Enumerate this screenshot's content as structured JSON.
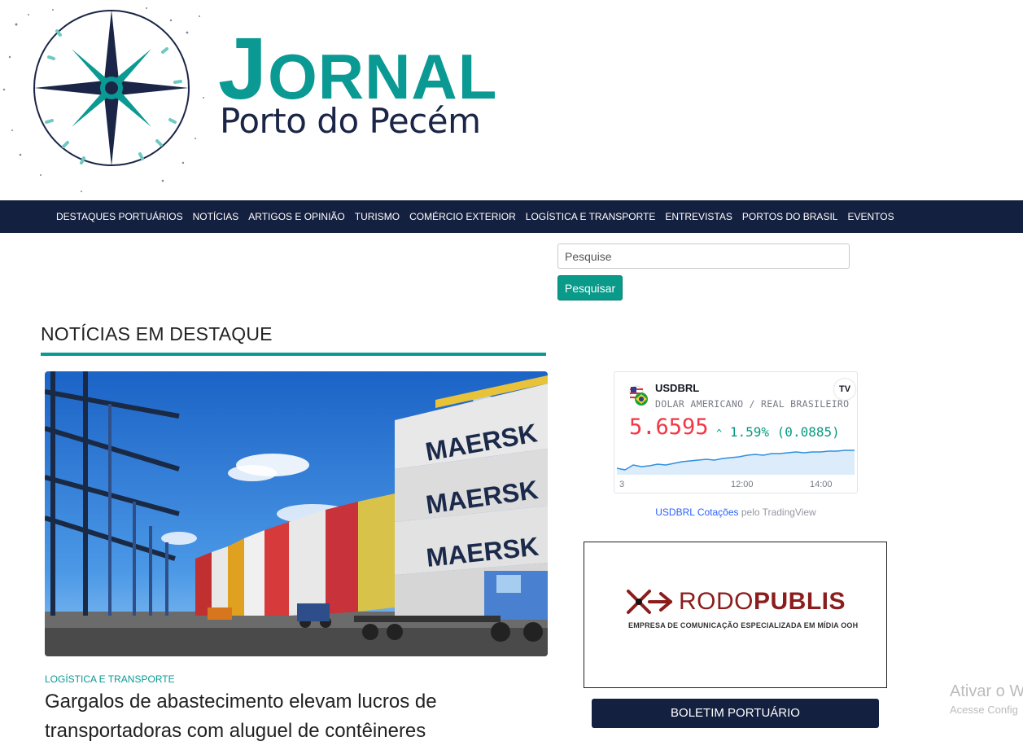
{
  "header": {
    "title_big": "J",
    "title_rest": "ORNAL",
    "subtitle": "Porto do Pecém"
  },
  "nav": {
    "items": [
      "DESTAQUES PORTUÁRIOS",
      "NOTÍCIAS",
      "ARTIGOS E OPINIÃO",
      "TURISMO",
      "COMÉRCIO EXTERIOR",
      "LOGÍSTICA E TRANSPORTE",
      "ENTREVISTAS",
      "PORTOS DO BRASIL",
      "EVENTOS"
    ]
  },
  "search": {
    "placeholder": "Pesquise",
    "button_label": "Pesquisar"
  },
  "section": {
    "title": "NOTÍCIAS EM DESTAQUE"
  },
  "featured": {
    "category": "LOGÍSTICA E TRANSPORTE",
    "headline": "Gargalos de abastecimento elevam lucros de transportadoras com aluguel de contêineres",
    "container_brand": "MAERSK"
  },
  "ticker": {
    "symbol": "USDBRL",
    "description": "DOLAR AMERICANO / REAL BRASILEIRO",
    "price": "5.6595",
    "change": "1.59% (0.0885)",
    "tv_icon": "tradingview-icon",
    "axis_labels": [
      "3",
      "12:00",
      "14:00"
    ],
    "credit_link": "USDBRL Cotações",
    "credit_text": " pelo TradingView",
    "colors": {
      "price": "#f23645",
      "change": "#089981"
    }
  },
  "ad": {
    "brand_thin": "RODO",
    "brand_bold": "PUBLIS",
    "tagline": "EMPRESA DE COMUNICAÇÃO ESPECIALIZADA EM MÍDIA OOH"
  },
  "boletim": {
    "label": "BOLETIM PORTUÁRIO"
  },
  "watermark": {
    "title": "Ativar o W",
    "subtitle": "Acesse Config"
  },
  "colors": {
    "brand_teal": "#0a9a93",
    "navy": "#14203f"
  }
}
